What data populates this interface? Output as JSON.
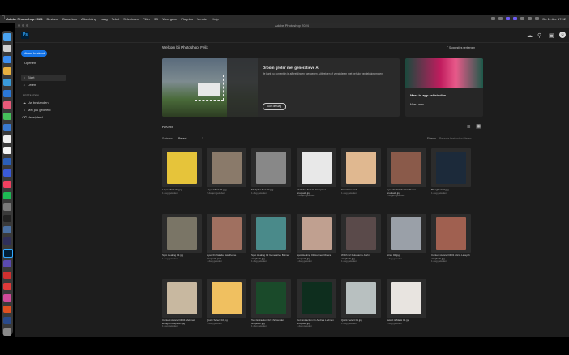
{
  "menubar": {
    "app": "Adobe Photoshop 2024",
    "items": [
      "Bestand",
      "Bewerken",
      "Afbeelding",
      "Laag",
      "Tekst",
      "Selecteren",
      "Filter",
      "3D",
      "Weergave",
      "Plug-ins",
      "Venster",
      "Help"
    ],
    "clock": "Do 11 Apr 17:52"
  },
  "window": {
    "title": "Adobe Photoshop 2024"
  },
  "header": {
    "logo": "Ps"
  },
  "sidebar": {
    "new_file": "Nieuw bestand",
    "open": "Openen",
    "items": [
      {
        "label": "Start",
        "icon": "home-icon"
      },
      {
        "label": "Leren",
        "icon": "lightbulb-icon"
      }
    ],
    "section": "BESTANDEN",
    "files": [
      {
        "label": "Uw bestanden",
        "icon": "cloud-icon"
      },
      {
        "label": "Met jou gedeeld",
        "icon": "share-icon"
      },
      {
        "label": "Verwijderd",
        "icon": "trash-icon"
      }
    ]
  },
  "main": {
    "welcome": "Welkom bij Photoshop, Felix",
    "suggestions": "Suggesties verbergen",
    "hero": {
      "title": "Droom groter met generatieve AI",
      "desc": "Je kunt nu content in je afbeeldingen toevoegen, uitbreiden of verwijderen met behulp van tekstprompten.",
      "button": "Aan de slag"
    },
    "promo": {
      "title": "Meer in-app zelfstudies",
      "link": "Meer Leren"
    },
    "recent_title": "Recent",
    "filter": {
      "label": "Sorteren",
      "value": "Recent"
    },
    "search_placeholder": "Recente bestanden filteren",
    "filter_label": "Filteren"
  },
  "files": [
    {
      "name": "Layer Mask 02.jpg",
      "sub": "1 dag geleden"
    },
    {
      "name": "Layer Mask 01.jpg",
      "sub": "2 dagen geleden"
    },
    {
      "name": "Multiplier Tool 02.jpg",
      "sub": "1 dag geleden"
    },
    {
      "name": "Multiplier Tool 01 Freepixel unsplash.jpg",
      "sub": "2 dagen geleden"
    },
    {
      "name": "Transform.psd",
      "sub": "1 dag geleden"
    },
    {
      "name": "Eyes 01 Natalie Hawthorne unsplash.jpg",
      "sub": "2 dagen geleden"
    },
    {
      "name": "Bleaghed 03.jpg",
      "sub": "1 dag geleden"
    },
    {
      "name": "Spot Healing 03.jpg",
      "sub": "1 dag geleden"
    },
    {
      "name": "Eyes 01 Natalie Hawthorne unsplash.psd",
      "sub": "1 dag geleden"
    },
    {
      "name": "Spot Healing 02 Generative Bolmer unsplash.jpg",
      "sub": "1 dag geleden"
    },
    {
      "name": "Spot Healing 01 Hermes Rivera unsplash.jpg",
      "sub": "1 dag geleden"
    },
    {
      "name": "Width 02 Rutuparna Joshi unsplash.jpg",
      "sub": "1 dag geleden"
    },
    {
      "name": "Strax 02.jpg",
      "sub": "1 dag geleden"
    },
    {
      "name": "Content Aware Fill 01 Alicia Latayah unsplash.jpg",
      "sub": "1 dag geleden"
    },
    {
      "name": "Content Aware Fill 04 Mehmeti Ertugrul unsplash.jpg",
      "sub": "1 dag geleden"
    },
    {
      "name": "Quick Select 02.jpg",
      "sub": "1 dag geleden"
    },
    {
      "name": "Text Extraction 02 Christender unsplash.jpg",
      "sub": "1 dag geleden"
    },
    {
      "name": "Text Extraction 01 Andrea Ladmen unsplash.jpg",
      "sub": "1 dag geleden"
    },
    {
      "name": "Quick Select 01.jpg",
      "sub": "1 dag geleden"
    },
    {
      "name": "Select & Mask 01.jpg",
      "sub": "1 dag geleden"
    }
  ],
  "thumb_colors": [
    "#e6c43a",
    "#8a7a6a",
    "#888888",
    "#e8e8e8",
    "#e0b890",
    "#8a5a4a",
    "#1c2a3a",
    "#7a7566",
    "#a07060",
    "#4a8a8a",
    "#c0a090",
    "#5a4a4a",
    "#9aa0a8",
    "#a06050",
    "#c8b8a0",
    "#f0c060",
    "#1a4a2a",
    "#0e2e1e",
    "#b8c0c0",
    "#e8e4e0"
  ]
}
